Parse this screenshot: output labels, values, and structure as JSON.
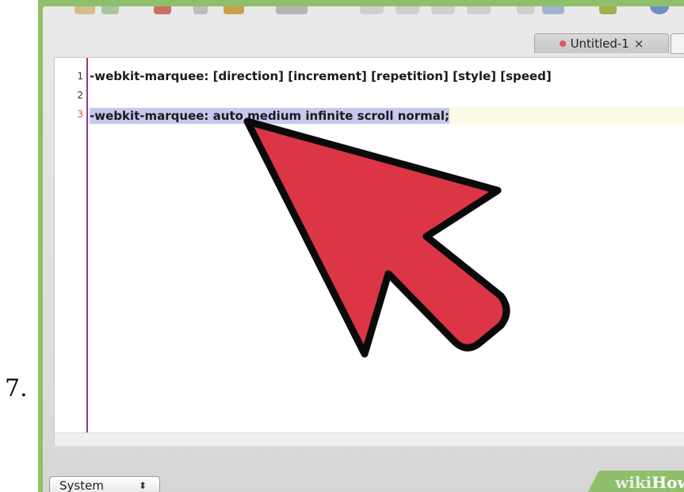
{
  "step": {
    "number": "7."
  },
  "tab": {
    "title": "Untitled-1",
    "close_glyph": "×"
  },
  "editor": {
    "lines": [
      {
        "number": "1",
        "text": "-webkit-marquee: [direction] [increment] [repetition] [style] [speed]"
      },
      {
        "number": "2",
        "text": ""
      },
      {
        "number": "3",
        "text": "-webkit-marquee: auto medium infinite scroll normal;",
        "selected": true
      }
    ]
  },
  "status_bar": {
    "syntax_mode": "System",
    "chevron": "⬍"
  },
  "watermark": {
    "wiki": "wiki",
    "how": "How"
  },
  "colors": {
    "frame_green": "#8fbf6b",
    "arrow_red": "#dc3545",
    "selection": "#c6c8ef",
    "gutter_rule": "#8d3a8d"
  },
  "icons": [
    "toolbar-icons",
    "close-icon",
    "pointer-arrow-icon",
    "chevron-updown-icon"
  ]
}
